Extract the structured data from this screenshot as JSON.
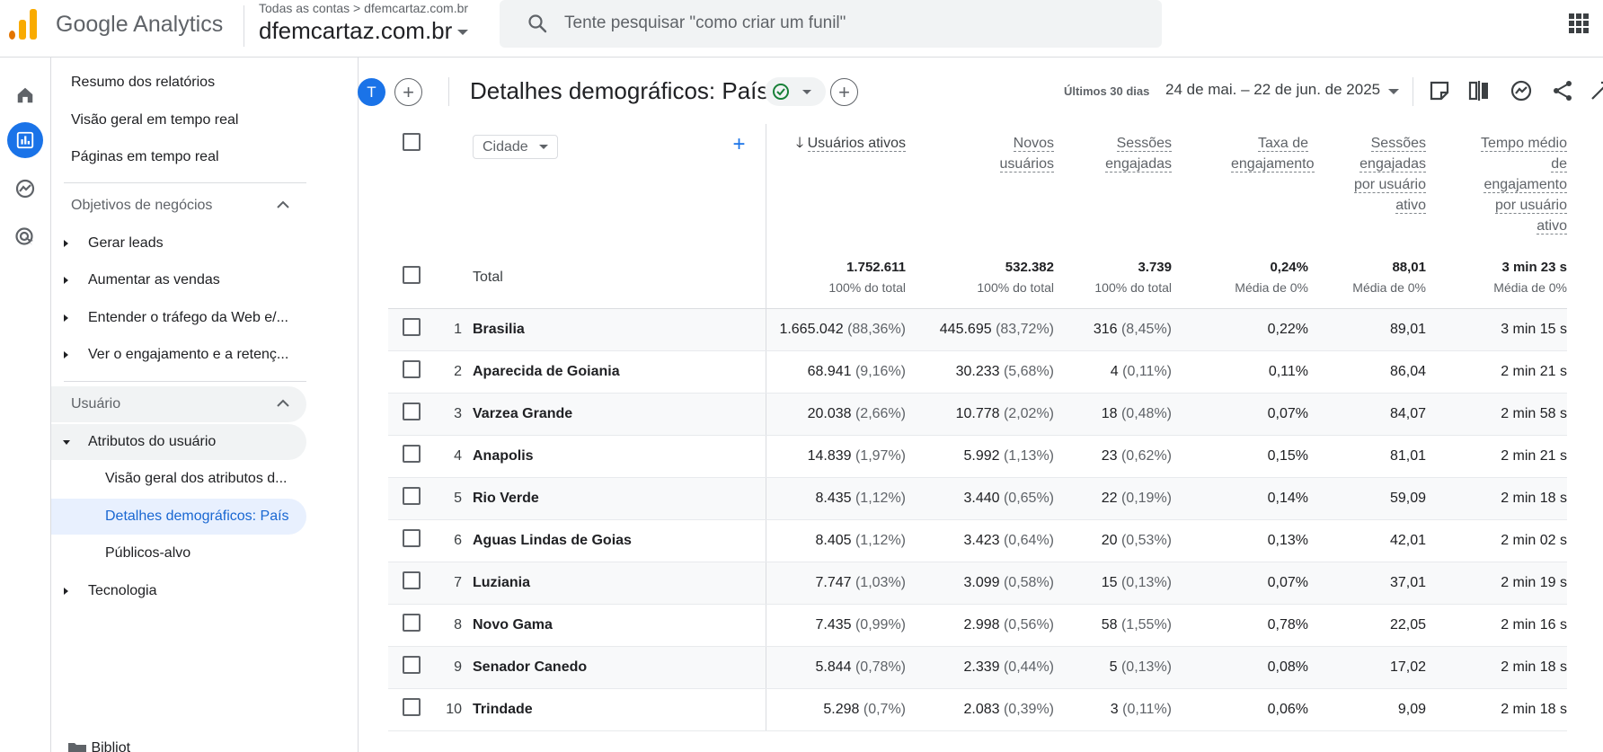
{
  "app": {
    "brand": "Google Analytics",
    "account_crumb": "Todas as contas > dfemcartaz.com.br",
    "property_name": "dfemcartaz.com.br",
    "search_placeholder": "Tente pesquisar \"como criar um funil\"",
    "accent_color": "#1a73e8"
  },
  "rail": {
    "icons": [
      "home-icon",
      "reports-icon",
      "explore-icon",
      "advertising-icon"
    ],
    "active": "reports-icon"
  },
  "sidebar": {
    "resumo": "Resumo dos relatórios",
    "visao_tempo_real": "Visão geral em tempo real",
    "paginas_tempo_real": "Páginas em tempo real",
    "objetivos_section": "Objetivos de negócios",
    "gerar_leads": "Gerar leads",
    "aumentar_vendas": "Aumentar as vendas",
    "entender_trafego": "Entender o tráfego da Web e/...",
    "ver_engajamento": "Ver o engajamento e a retenç...",
    "usuario_section": "Usuário",
    "atributos": "Atributos do usuário",
    "visao_atributos": "Visão geral dos atributos d...",
    "detalhes_pais": "Detalhes demográficos: País",
    "publicos_alvo": "Públicos-alvo",
    "tecnologia": "Tecnologia",
    "biblioteca": "Bibliot"
  },
  "report": {
    "avatar_letter": "T",
    "title": "Detalhes demográficos: País",
    "date_label": "Últimos 30 dias",
    "date_range": "24 de mai. – 22 de jun. de 2025"
  },
  "table": {
    "dimension_label": "Cidade",
    "columns": [
      {
        "label": "Usuários ativos",
        "sorted": true
      },
      {
        "label": "Novos usuários"
      },
      {
        "label": "Sessões engajadas"
      },
      {
        "label": "Taxa de engajamento"
      },
      {
        "label": "Sessões engajadas por usuário ativo"
      },
      {
        "label": "Tempo médio de engajamento por usuário ativo"
      }
    ],
    "total": {
      "label": "Total",
      "values": [
        "1.752.611",
        "532.382",
        "3.739",
        "0,24%",
        "88,01",
        "3 min 23 s"
      ],
      "subs": [
        "100% do total",
        "100% do total",
        "100% do total",
        "Média de 0%",
        "Média de 0%",
        "Média de 0%"
      ]
    },
    "rows": [
      {
        "idx": "1",
        "city": "Brasilia",
        "users": "1.665.042",
        "users_pct": "(88,36%)",
        "new": "445.695",
        "new_pct": "(83,72%)",
        "sess": "316",
        "sess_pct": "(8,45%)",
        "rate": "0,22%",
        "per_user": "89,01",
        "time": "3 min 15 s"
      },
      {
        "idx": "2",
        "city": "Aparecida de Goiania",
        "users": "68.941",
        "users_pct": "(9,16%)",
        "new": "30.233",
        "new_pct": "(5,68%)",
        "sess": "4",
        "sess_pct": "(0,11%)",
        "rate": "0,11%",
        "per_user": "86,04",
        "time": "2 min 21 s"
      },
      {
        "idx": "3",
        "city": "Varzea Grande",
        "users": "20.038",
        "users_pct": "(2,66%)",
        "new": "10.778",
        "new_pct": "(2,02%)",
        "sess": "18",
        "sess_pct": "(0,48%)",
        "rate": "0,07%",
        "per_user": "84,07",
        "time": "2 min 58 s"
      },
      {
        "idx": "4",
        "city": "Anapolis",
        "users": "14.839",
        "users_pct": "(1,97%)",
        "new": "5.992",
        "new_pct": "(1,13%)",
        "sess": "23",
        "sess_pct": "(0,62%)",
        "rate": "0,15%",
        "per_user": "81,01",
        "time": "2 min 21 s"
      },
      {
        "idx": "5",
        "city": "Rio Verde",
        "users": "8.435",
        "users_pct": "(1,12%)",
        "new": "3.440",
        "new_pct": "(0,65%)",
        "sess": "22",
        "sess_pct": "(0,19%)",
        "rate": "0,14%",
        "per_user": "59,09",
        "time": "2 min 18 s"
      },
      {
        "idx": "6",
        "city": "Aguas Lindas de Goias",
        "users": "8.405",
        "users_pct": "(1,12%)",
        "new": "3.423",
        "new_pct": "(0,64%)",
        "sess": "20",
        "sess_pct": "(0,53%)",
        "rate": "0,13%",
        "per_user": "42,01",
        "time": "2 min 02 s"
      },
      {
        "idx": "7",
        "city": "Luziania",
        "users": "7.747",
        "users_pct": "(1,03%)",
        "new": "3.099",
        "new_pct": "(0,58%)",
        "sess": "15",
        "sess_pct": "(0,13%)",
        "rate": "0,07%",
        "per_user": "37,01",
        "time": "2 min 19 s"
      },
      {
        "idx": "8",
        "city": "Novo Gama",
        "users": "7.435",
        "users_pct": "(0,99%)",
        "new": "2.998",
        "new_pct": "(0,56%)",
        "sess": "58",
        "sess_pct": "(1,55%)",
        "rate": "0,78%",
        "per_user": "22,05",
        "time": "2 min 16 s"
      },
      {
        "idx": "9",
        "city": "Senador Canedo",
        "users": "5.844",
        "users_pct": "(0,78%)",
        "new": "2.339",
        "new_pct": "(0,44%)",
        "sess": "5",
        "sess_pct": "(0,13%)",
        "rate": "0,08%",
        "per_user": "17,02",
        "time": "2 min 18 s"
      },
      {
        "idx": "10",
        "city": "Trindade",
        "users": "5.298",
        "users_pct": "(0,7%)",
        "new": "2.083",
        "new_pct": "(0,39%)",
        "sess": "3",
        "sess_pct": "(0,11%)",
        "rate": "0,06%",
        "per_user": "9,09",
        "time": "2 min 18 s"
      }
    ]
  }
}
